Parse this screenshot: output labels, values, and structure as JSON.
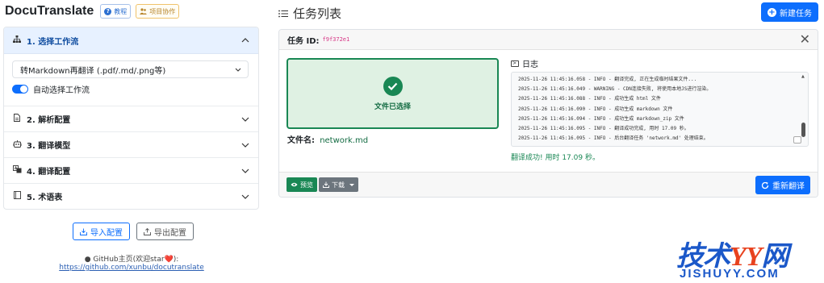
{
  "app": {
    "title": "DocuTranslate",
    "tutorial_label": "教程",
    "collab_label": "项目协作"
  },
  "sidebar": {
    "sections": [
      {
        "label": "1. 选择工作流",
        "icon": "sitemap-icon",
        "expanded": true
      },
      {
        "label": "2. 解析配置",
        "icon": "file-icon",
        "expanded": false
      },
      {
        "label": "3. 翻译模型",
        "icon": "robot-icon",
        "expanded": false
      },
      {
        "label": "4. 翻译配置",
        "icon": "language-icon",
        "expanded": false
      },
      {
        "label": "5. 术语表",
        "icon": "book-icon",
        "expanded": false
      }
    ],
    "workflow_select": "转Markdown再翻译 (.pdf/.md/.png等)",
    "auto_workflow_label": "自动选择工作流",
    "auto_workflow_on": true
  },
  "config": {
    "import_label": "导入配置",
    "export_label": "导出配置"
  },
  "footer": {
    "github_label": "GitHub主页(欢迎star❤️):",
    "github_url": "https://github.com/xunbu/docutranslate"
  },
  "tasks": {
    "header": "任务列表",
    "new_task_label": "新建任务",
    "accent_color": "#0d6efd",
    "success_color": "#198754"
  },
  "task": {
    "id_label": "任务 ID:",
    "id_value": "f9f372e1",
    "file_status": "文件已选择",
    "file_name_label": "文件名:",
    "file_name": "network.md",
    "log_title": "日志",
    "logs": [
      "2025-11-26 11:45:16.058 - INFO - 翻译完成, 正在生成临时结果文件...",
      "2025-11-26 11:45:16.049 - WARNING - CDN连接失败, 将使用本地JS进行渲染。",
      "2025-11-26 11:45:16.088 - INFO - 成功生成 html 文件",
      "2025-11-26 11:45:16.090 - INFO - 成功生成 markdown 文件",
      "2025-11-26 11:45:16.094 - INFO - 成功生成 markdown_zip 文件",
      "2025-11-26 11:45:16.095 - INFO - 翻译成功完成, 用时 17.09 秒。",
      "2025-11-26 11:45:16.095 - INFO - 后台翻译任务 'network.md' 处理结束。"
    ],
    "success_message": "翻译成功! 用时 17.09 秒。",
    "preview_label": "预览",
    "download_label": "下载",
    "retranslate_label": "重新翻译"
  },
  "watermark": {
    "text_a": "技术",
    "text_b": "YY",
    "text_c": "网",
    "sub": "JISHUYY.COM"
  }
}
